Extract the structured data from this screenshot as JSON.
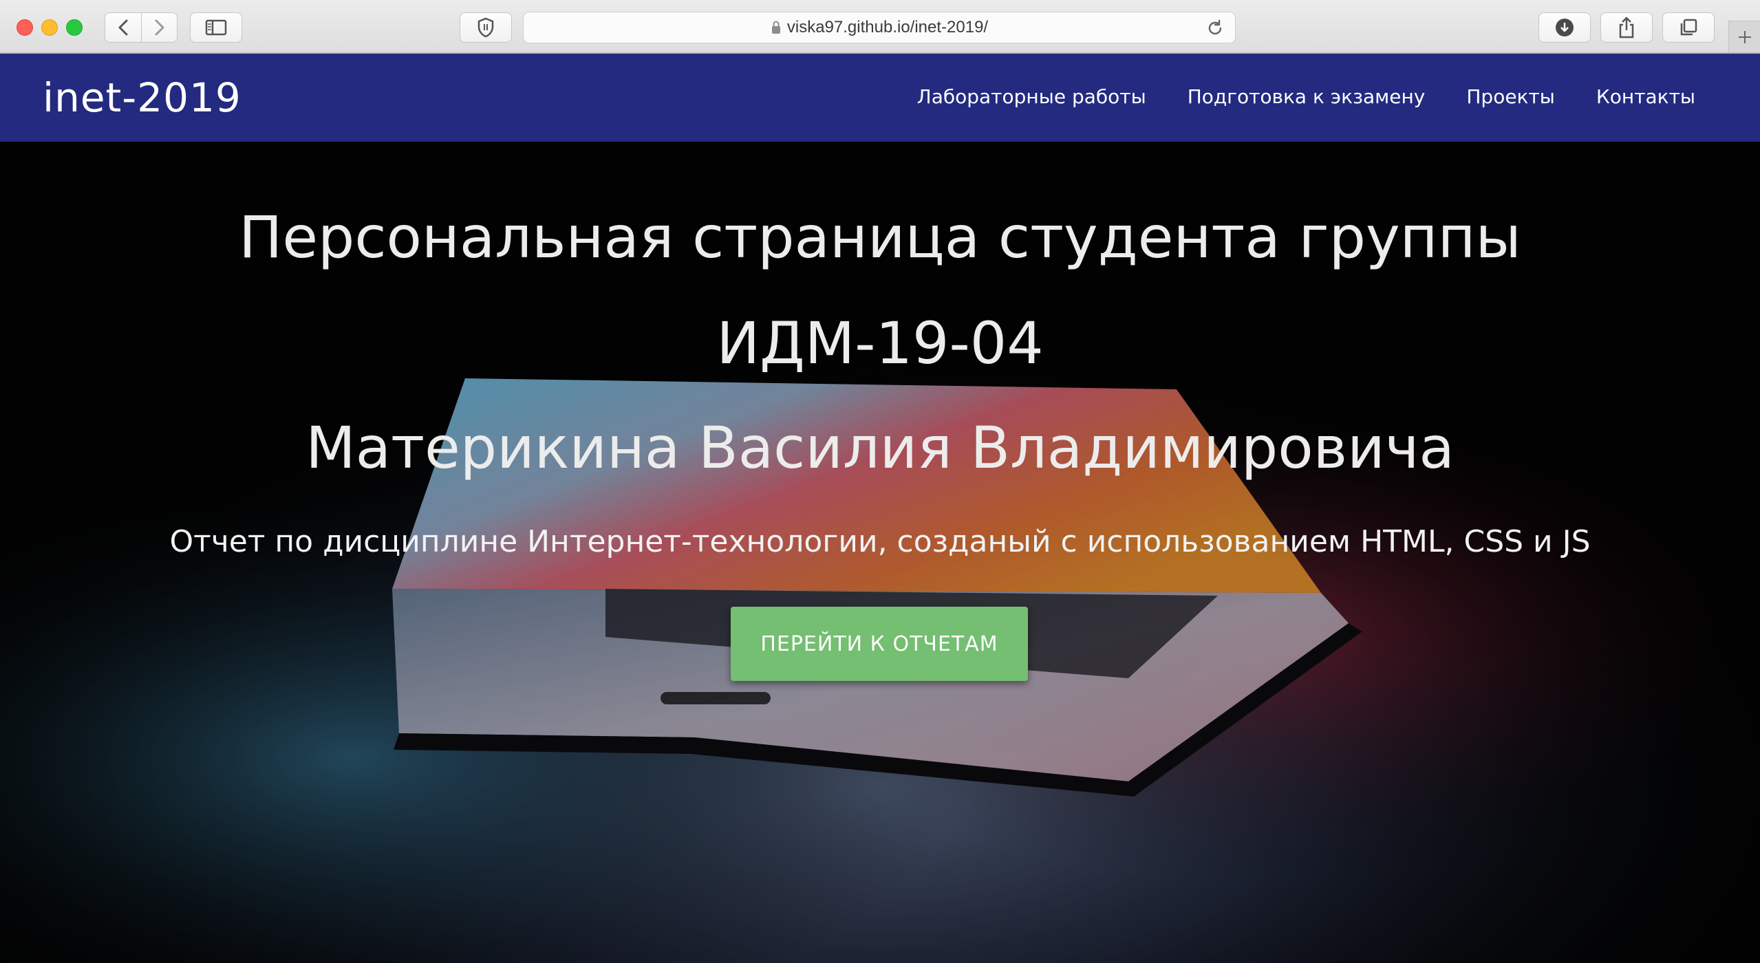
{
  "browser": {
    "url": "viska97.github.io/inet-2019/",
    "icons": [
      "back-icon",
      "forward-icon",
      "sidebar-icon",
      "shield-icon",
      "lock-icon",
      "reload-icon",
      "download-icon",
      "share-icon",
      "tabs-icon",
      "new-tab-icon"
    ]
  },
  "navbar": {
    "brand": "inet-2019",
    "background": "#232a80",
    "links": [
      {
        "label": "Лабораторные работы"
      },
      {
        "label": "Подготовка к экзамену"
      },
      {
        "label": "Проекты"
      },
      {
        "label": "Контакты"
      }
    ]
  },
  "hero": {
    "title_line1": "Персональная страница студента группы",
    "title_line2": "ИДМ-19-04",
    "title_line3": "Материкина Василия Владимировича",
    "subtitle": "Отчет по дисциплине Интернет-технологии, созданый с использованием HTML, CSS и JS",
    "cta_label": "ПЕРЕЙТИ К ОТЧЕТАМ",
    "cta_color": "#74bf71"
  }
}
